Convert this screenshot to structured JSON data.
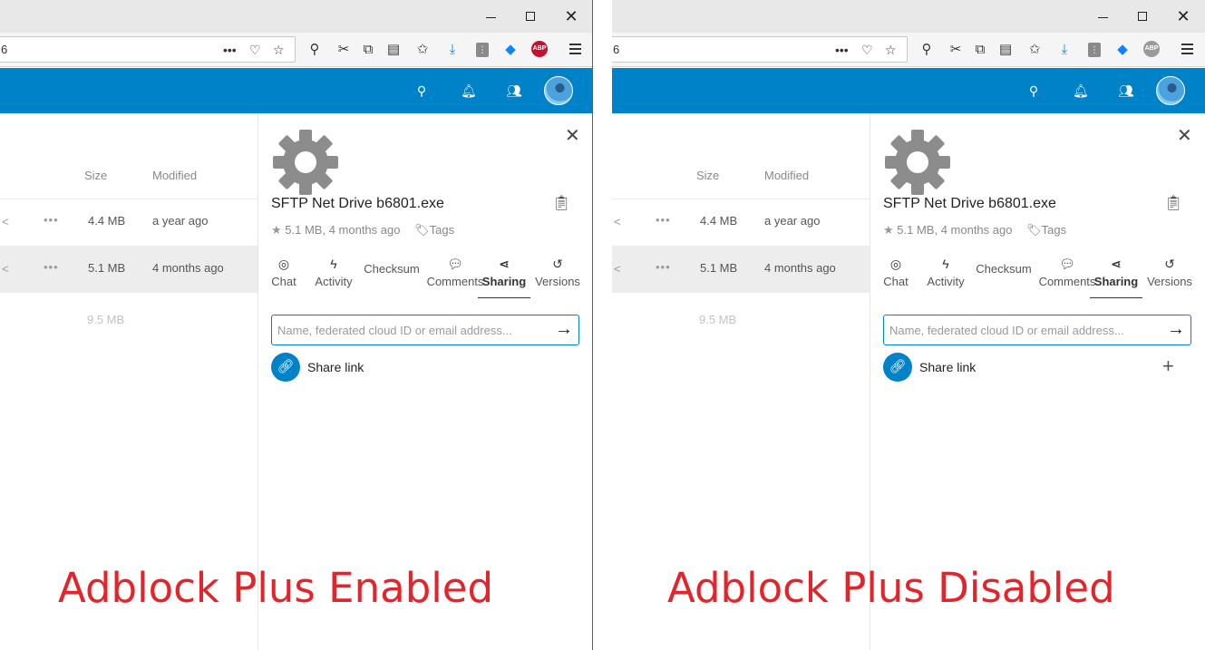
{
  "browser": {
    "window_controls": {
      "minimize": "—",
      "maximize": "□",
      "close": "✕"
    },
    "url_text": "6",
    "page_actions": "•••",
    "abp_label": "ABP"
  },
  "file_list": {
    "columns": {
      "size": "Size",
      "modified": "Modified"
    },
    "rows": [
      {
        "size": "4.4 MB",
        "modified": "a year ago",
        "selected": false
      },
      {
        "size": "5.1 MB",
        "modified": "4 months ago",
        "selected": true
      }
    ],
    "total_size": "9.5 MB"
  },
  "sidebar": {
    "file_name": "SFTP Net Drive b6801.exe",
    "meta": "5.1 MB, 4 months ago",
    "tags_label": "Tags",
    "tabs": [
      {
        "label": "Chat",
        "icon": "chat-icon"
      },
      {
        "label": "Activity",
        "icon": "lightning-icon"
      },
      {
        "label": "Checksum",
        "icon": ""
      },
      {
        "label": "Comments",
        "icon": "comment-icon"
      },
      {
        "label": "Sharing",
        "icon": "share-icon",
        "active": true
      },
      {
        "label": "Versions",
        "icon": "history-icon"
      }
    ],
    "share_placeholder": "Name, federated cloud ID or email address...",
    "share_link_label": "Share link"
  },
  "captions": {
    "left": "Adblock Plus Enabled",
    "right": "Adblock Plus Disabled"
  },
  "colors": {
    "header_blue": "#0082c9",
    "caption_red": "#e3242b",
    "abp_enabled": "#c8102e",
    "abp_disabled": "#9a9a9a"
  }
}
